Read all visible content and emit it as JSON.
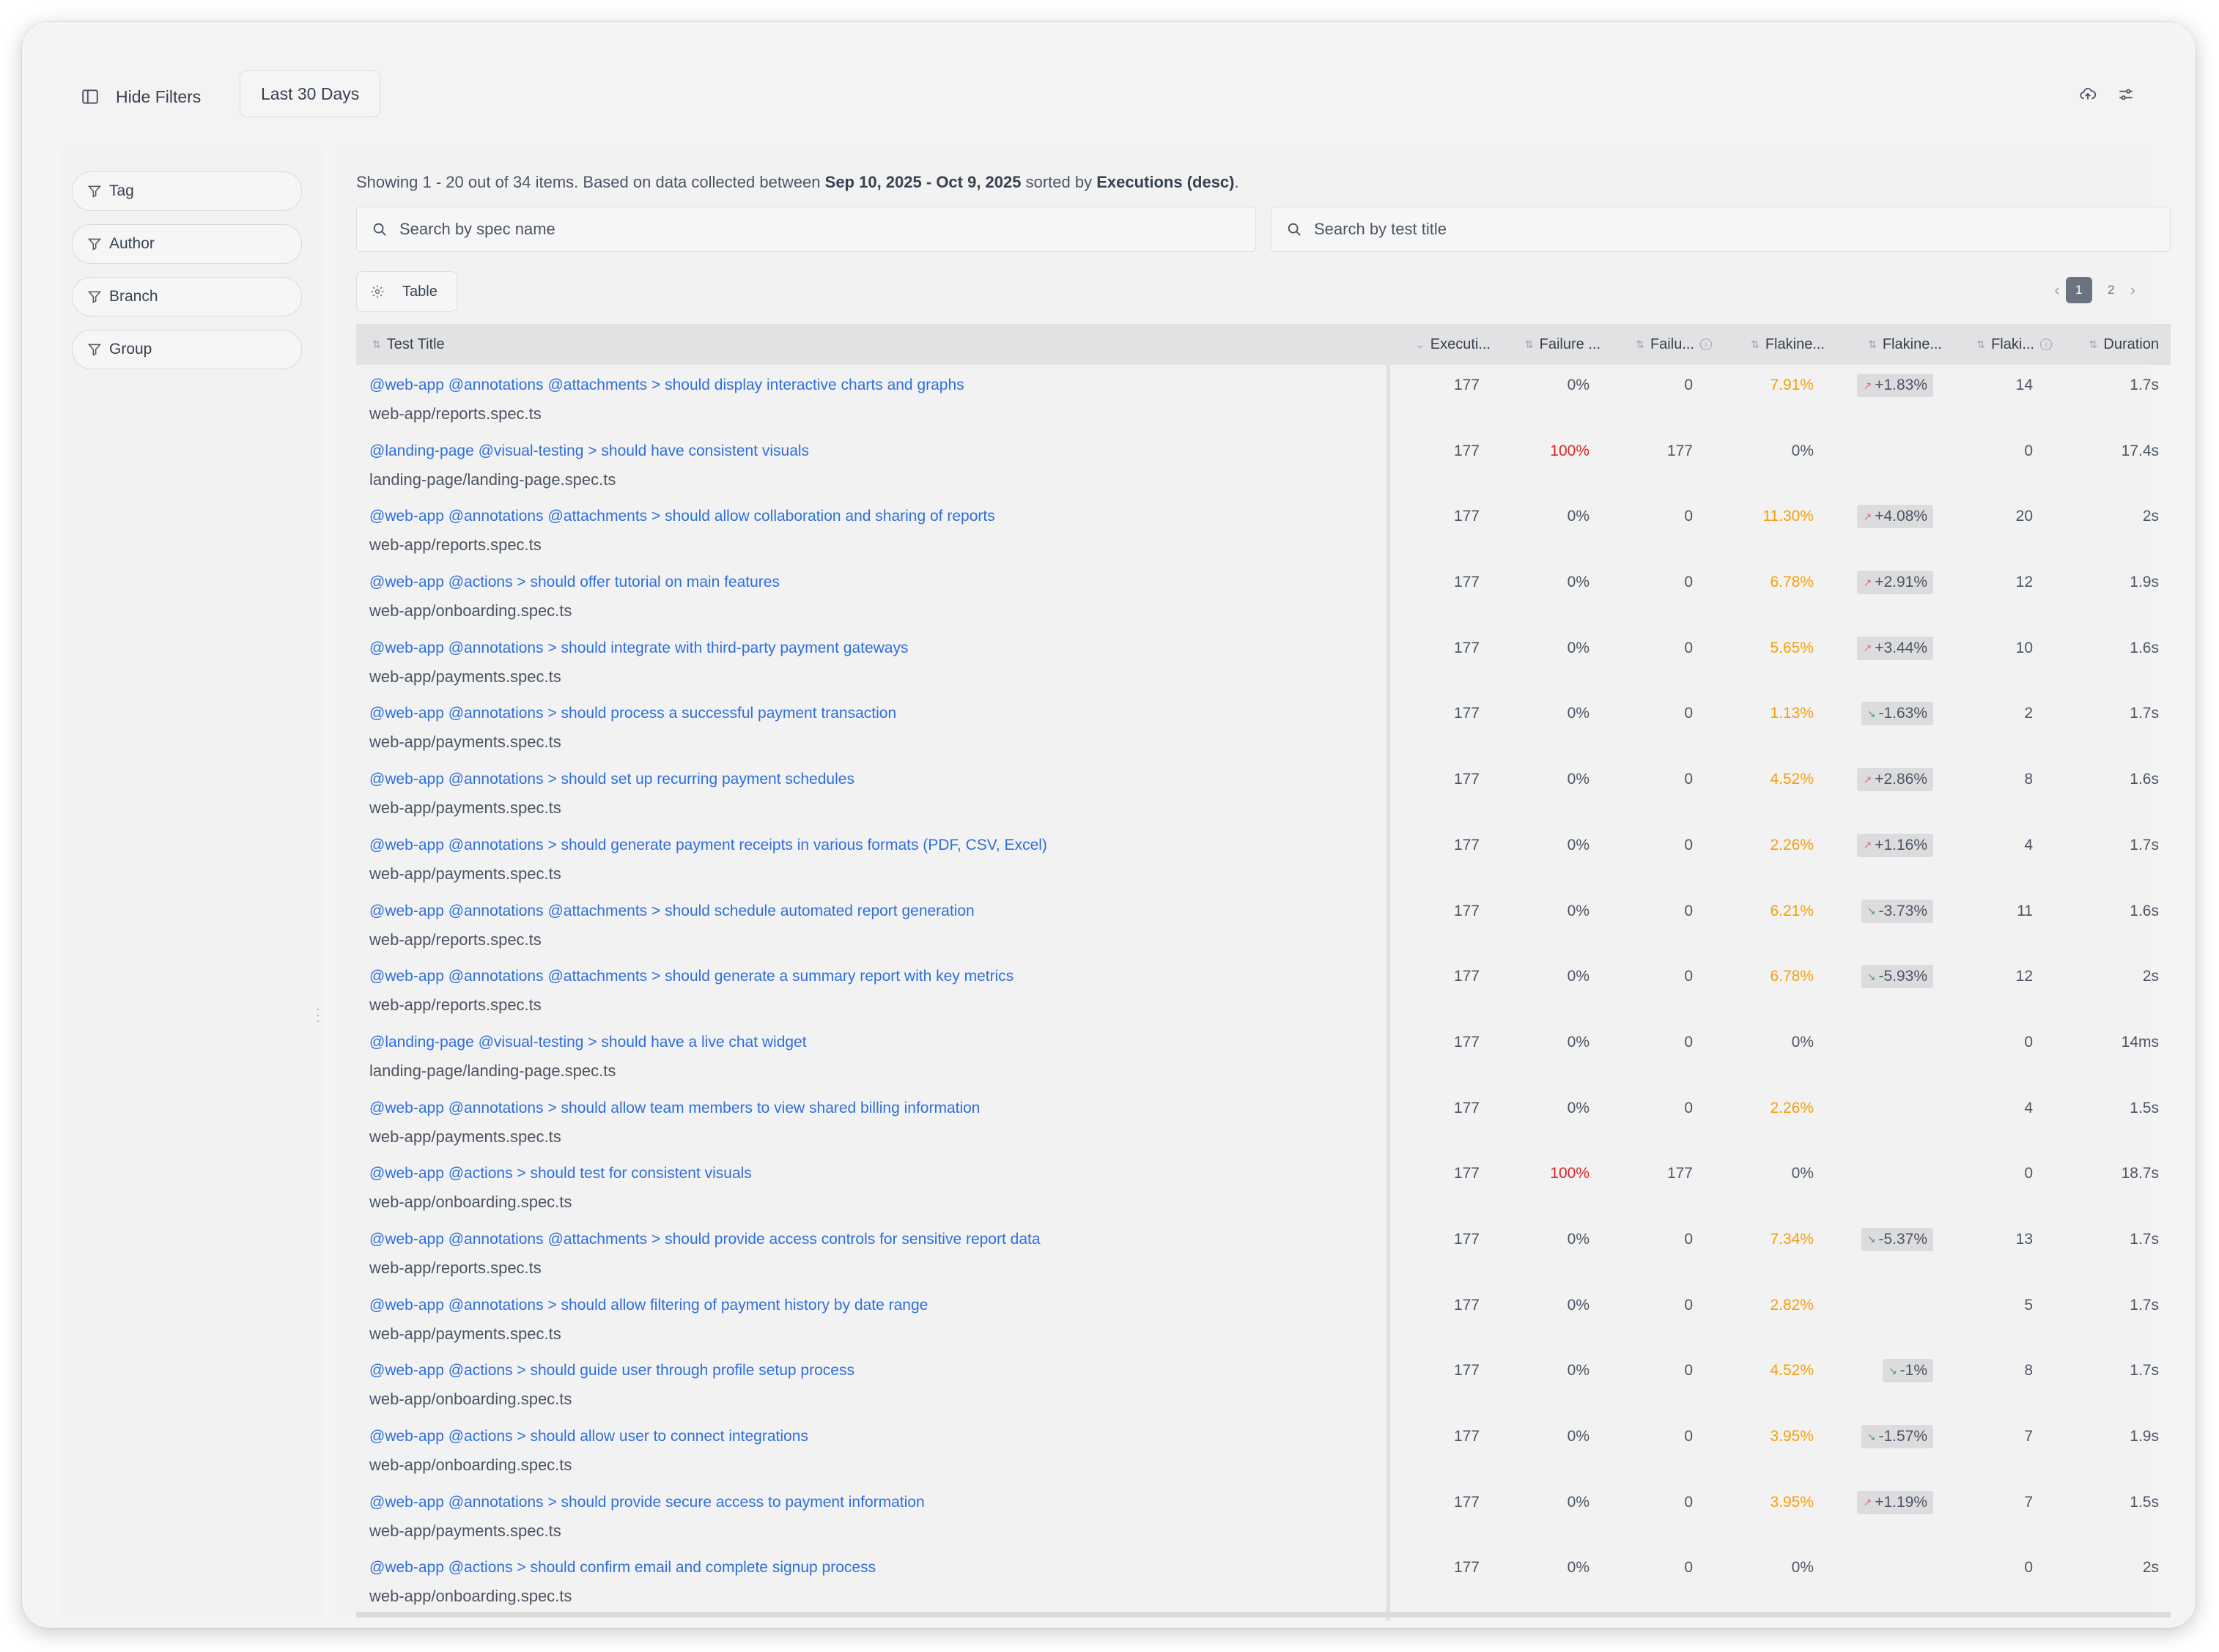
{
  "toolbar": {
    "hide_filters_label": "Hide Filters",
    "date_range_label": "Last 30 Days"
  },
  "filters": [
    {
      "label": "Tag"
    },
    {
      "label": "Author"
    },
    {
      "label": "Branch"
    },
    {
      "label": "Group"
    }
  ],
  "summary": {
    "prefix": "Showing 1 - 20 out of 34 items. Based on data collected between ",
    "date_from": "Sep 10, 2025",
    "separator": " - ",
    "date_to": "Oct 9, 2025",
    "sorted_by_text": " sorted by ",
    "sort_field": "Executions (desc)",
    "suffix": "."
  },
  "search": {
    "spec_placeholder": "Search by spec name",
    "title_placeholder": "Search by test title"
  },
  "view": {
    "label": "Table"
  },
  "pagination": {
    "pages": [
      "1",
      "2"
    ],
    "current": "1"
  },
  "columns": {
    "test_title": "Test Title",
    "executions": "Executi...",
    "failure_rate": "Failure ...",
    "failures": "Failu...",
    "flakiness_rate": "Flakine...",
    "flakiness_trend": "Flakine...",
    "flaky": "Flaki...",
    "duration": "Duration"
  },
  "rows": [
    {
      "title": "@web-app @annotations @attachments > should display interactive charts and graphs",
      "spec": "web-app/reports.spec.ts",
      "executions": "177",
      "failure_rate": "0%",
      "failures": "0",
      "flakiness": "7.91%",
      "trend": "+1.83%",
      "trend_dir": "up",
      "flaky": "14",
      "duration": "1.7s"
    },
    {
      "title": "@landing-page @visual-testing > should have consistent visuals",
      "spec": "landing-page/landing-page.spec.ts",
      "executions": "177",
      "failure_rate": "100%",
      "failures": "177",
      "flakiness": "0%",
      "trend": "",
      "trend_dir": "",
      "flaky": "0",
      "duration": "17.4s"
    },
    {
      "title": "@web-app @annotations @attachments > should allow collaboration and sharing of reports",
      "spec": "web-app/reports.spec.ts",
      "executions": "177",
      "failure_rate": "0%",
      "failures": "0",
      "flakiness": "11.30%",
      "trend": "+4.08%",
      "trend_dir": "up",
      "flaky": "20",
      "duration": "2s"
    },
    {
      "title": "@web-app @actions > should offer tutorial on main features",
      "spec": "web-app/onboarding.spec.ts",
      "executions": "177",
      "failure_rate": "0%",
      "failures": "0",
      "flakiness": "6.78%",
      "trend": "+2.91%",
      "trend_dir": "up",
      "flaky": "12",
      "duration": "1.9s"
    },
    {
      "title": "@web-app @annotations > should integrate with third-party payment gateways",
      "spec": "web-app/payments.spec.ts",
      "executions": "177",
      "failure_rate": "0%",
      "failures": "0",
      "flakiness": "5.65%",
      "trend": "+3.44%",
      "trend_dir": "up",
      "flaky": "10",
      "duration": "1.6s"
    },
    {
      "title": "@web-app @annotations > should process a successful payment transaction",
      "spec": "web-app/payments.spec.ts",
      "executions": "177",
      "failure_rate": "0%",
      "failures": "0",
      "flakiness": "1.13%",
      "trend": "-1.63%",
      "trend_dir": "down",
      "flaky": "2",
      "duration": "1.7s"
    },
    {
      "title": "@web-app @annotations > should set up recurring payment schedules",
      "spec": "web-app/payments.spec.ts",
      "executions": "177",
      "failure_rate": "0%",
      "failures": "0",
      "flakiness": "4.52%",
      "trend": "+2.86%",
      "trend_dir": "up",
      "flaky": "8",
      "duration": "1.6s"
    },
    {
      "title": "@web-app @annotations > should generate payment receipts in various formats (PDF, CSV, Excel)",
      "spec": "web-app/payments.spec.ts",
      "executions": "177",
      "failure_rate": "0%",
      "failures": "0",
      "flakiness": "2.26%",
      "trend": "+1.16%",
      "trend_dir": "up",
      "flaky": "4",
      "duration": "1.7s"
    },
    {
      "title": "@web-app @annotations @attachments > should schedule automated report generation",
      "spec": "web-app/reports.spec.ts",
      "executions": "177",
      "failure_rate": "0%",
      "failures": "0",
      "flakiness": "6.21%",
      "trend": "-3.73%",
      "trend_dir": "down",
      "flaky": "11",
      "duration": "1.6s"
    },
    {
      "title": "@web-app @annotations @attachments > should generate a summary report with key metrics",
      "spec": "web-app/reports.spec.ts",
      "executions": "177",
      "failure_rate": "0%",
      "failures": "0",
      "flakiness": "6.78%",
      "trend": "-5.93%",
      "trend_dir": "down",
      "flaky": "12",
      "duration": "2s"
    },
    {
      "title": "@landing-page @visual-testing > should have a live chat widget",
      "spec": "landing-page/landing-page.spec.ts",
      "executions": "177",
      "failure_rate": "0%",
      "failures": "0",
      "flakiness": "0%",
      "trend": "",
      "trend_dir": "",
      "flaky": "0",
      "duration": "14ms"
    },
    {
      "title": "@web-app @annotations > should allow team members to view shared billing information",
      "spec": "web-app/payments.spec.ts",
      "executions": "177",
      "failure_rate": "0%",
      "failures": "0",
      "flakiness": "2.26%",
      "trend": "",
      "trend_dir": "",
      "flaky": "4",
      "duration": "1.5s"
    },
    {
      "title": "@web-app @actions > should test for consistent visuals",
      "spec": "web-app/onboarding.spec.ts",
      "executions": "177",
      "failure_rate": "100%",
      "failures": "177",
      "flakiness": "0%",
      "trend": "",
      "trend_dir": "",
      "flaky": "0",
      "duration": "18.7s"
    },
    {
      "title": "@web-app @annotations @attachments > should provide access controls for sensitive report data",
      "spec": "web-app/reports.spec.ts",
      "executions": "177",
      "failure_rate": "0%",
      "failures": "0",
      "flakiness": "7.34%",
      "trend": "-5.37%",
      "trend_dir": "down",
      "flaky": "13",
      "duration": "1.7s"
    },
    {
      "title": "@web-app @annotations > should allow filtering of payment history by date range",
      "spec": "web-app/payments.spec.ts",
      "executions": "177",
      "failure_rate": "0%",
      "failures": "0",
      "flakiness": "2.82%",
      "trend": "",
      "trend_dir": "",
      "flaky": "5",
      "duration": "1.7s"
    },
    {
      "title": "@web-app @actions > should guide user through profile setup process",
      "spec": "web-app/onboarding.spec.ts",
      "executions": "177",
      "failure_rate": "0%",
      "failures": "0",
      "flakiness": "4.52%",
      "trend": "-1%",
      "trend_dir": "down",
      "flaky": "8",
      "duration": "1.7s"
    },
    {
      "title": "@web-app @actions > should allow user to connect integrations",
      "spec": "web-app/onboarding.spec.ts",
      "executions": "177",
      "failure_rate": "0%",
      "failures": "0",
      "flakiness": "3.95%",
      "trend": "-1.57%",
      "trend_dir": "down",
      "flaky": "7",
      "duration": "1.9s"
    },
    {
      "title": "@web-app @annotations > should provide secure access to payment information",
      "spec": "web-app/payments.spec.ts",
      "executions": "177",
      "failure_rate": "0%",
      "failures": "0",
      "flakiness": "3.95%",
      "trend": "+1.19%",
      "trend_dir": "up",
      "flaky": "7",
      "duration": "1.5s"
    },
    {
      "title": "@web-app @actions > should confirm email and complete signup process",
      "spec": "web-app/onboarding.spec.ts",
      "executions": "177",
      "failure_rate": "0%",
      "failures": "0",
      "flakiness": "0%",
      "trend": "",
      "trend_dir": "",
      "flaky": "0",
      "duration": "2s"
    }
  ],
  "colors": {
    "link": "#2f6fdb",
    "failure": "#dc2626",
    "flakiness": "#f59e0b",
    "trend_up": "#e26a6a",
    "trend_down": "#45a06a"
  },
  "icons": {
    "sidebar_toggle": "sidebar-toggle-icon",
    "filter": "filter-icon",
    "search": "search-icon",
    "settings": "gear-icon",
    "cloud_upload": "cloud-upload-icon",
    "sliders": "sliders-icon"
  }
}
